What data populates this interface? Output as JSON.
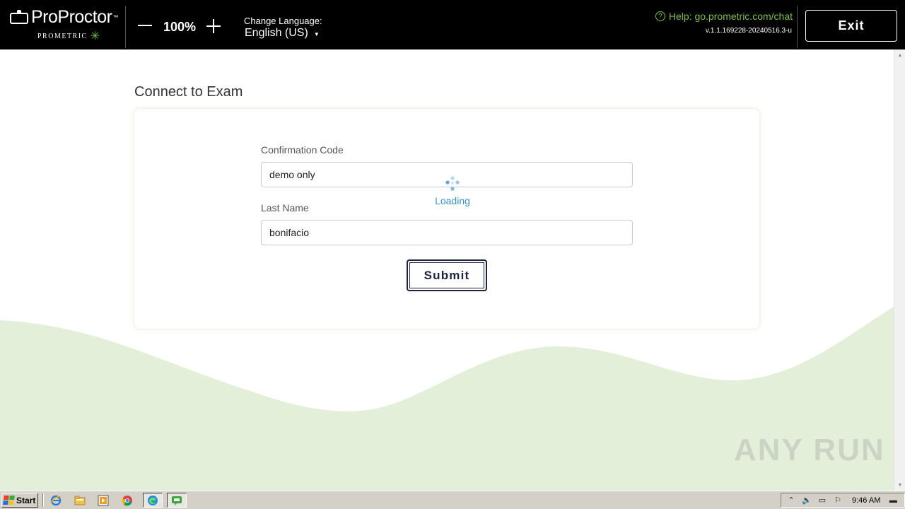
{
  "header": {
    "logo_text": "ProProctor",
    "logo_tm": "™",
    "logo_sub": "PROMETRIC",
    "zoom": "100%",
    "language_label": "Change Language:",
    "language_value": "English (US)",
    "help_text": "Help: go.prometric.com/chat",
    "version": "v.1.1.169228-20240516.3-u",
    "exit_label": "Exit",
    "colors": {
      "help": "#7bbf4f",
      "background": "#000000"
    }
  },
  "main": {
    "title": "Connect to Exam",
    "confirmation_label": "Confirmation Code",
    "confirmation_value": "demo only",
    "lastname_label": "Last Name",
    "lastname_value": "bonifacio",
    "submit_label": "Submit",
    "loading_text": "Loading",
    "colors": {
      "wave": "#e4efd9",
      "button_border": "#1e2340",
      "loading": "#3a8ec8"
    }
  },
  "watermark": "ANY RUN",
  "taskbar": {
    "start_label": "Start",
    "pinned_icons": [
      "internet-explorer-icon",
      "folder-icon",
      "media-player-icon",
      "chrome-icon",
      "edge-icon",
      "chat-app-icon"
    ],
    "tray_icons": [
      "show-hidden-icon",
      "volume-icon",
      "network-icon",
      "flag-icon",
      "desktop-icon"
    ],
    "clock": "9:46 AM"
  }
}
